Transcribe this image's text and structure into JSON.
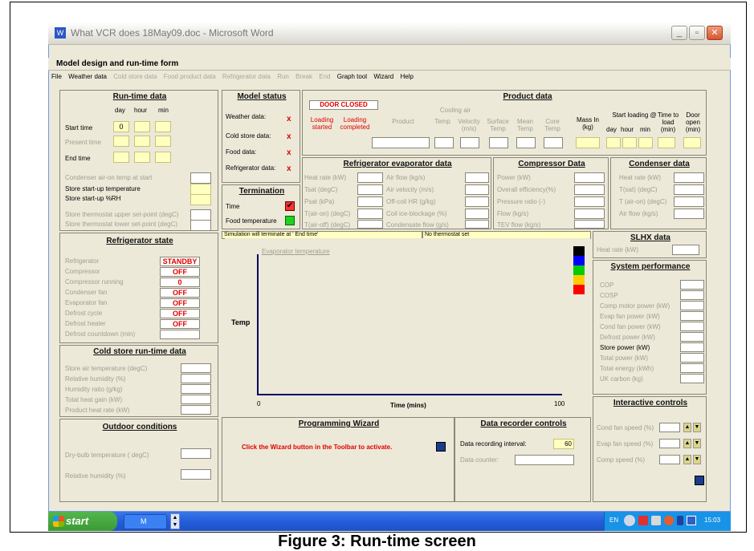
{
  "window": {
    "title": "What VCR does 18May09.doc - Microsoft Word",
    "minimize": "_",
    "restore": "▫",
    "close": "✕"
  },
  "form_title": "Model design and run-time form",
  "menu": [
    {
      "label": "File",
      "enabled": true
    },
    {
      "label": "Weather data",
      "enabled": true
    },
    {
      "label": "Cold store data",
      "enabled": false
    },
    {
      "label": "Food product data",
      "enabled": false
    },
    {
      "label": "Refrigerator data",
      "enabled": false
    },
    {
      "label": "Run",
      "enabled": false
    },
    {
      "label": "Break",
      "enabled": false
    },
    {
      "label": "End",
      "enabled": false
    },
    {
      "label": "Graph tool",
      "enabled": true
    },
    {
      "label": "Wizard",
      "enabled": true
    },
    {
      "label": "Help",
      "enabled": true
    }
  ],
  "runtime": {
    "title": "Run-time data",
    "col_day": "day",
    "col_hour": "hour",
    "col_min": "min",
    "start_time": "Start time",
    "start_day_value": "0",
    "present_time": "Present time",
    "end_time": "End time",
    "condenser_air": "Condenser air-on temp at start",
    "store_startup_temp": "Store start-up temperature",
    "store_startup_rh": "Store start-up %RH",
    "thermo_upper": "Store thermostat upper set-point (degC)",
    "thermo_lower": "Store thermostat lower set-point (degC)"
  },
  "model_status": {
    "title": "Model status",
    "weather": "Weather data:",
    "cold_store": "Cold store data:",
    "food": "Food data:",
    "refrigerator": "Refrigerator data:",
    "x": "x"
  },
  "termination": {
    "title": "Termination",
    "time": "Time",
    "food_temp": "Food temperature",
    "check": "✔"
  },
  "product": {
    "title": "Product data",
    "door": "DOOR CLOSED",
    "loading_started": "Loading started",
    "loading_completed": "Loading completed",
    "product": "Product",
    "cooling_air": "Cooling air",
    "temp": "Temp",
    "velocity": "Velocity (m/s)",
    "surface_temp": "Surface Temp",
    "mean_temp": "Mean Temp",
    "core_temp": "Core Temp",
    "mass": "Mass In (kg)",
    "start_loading": "Start loading @",
    "day": "day",
    "hour": "hour",
    "min": "min",
    "time_to_load": "Time to load (min)",
    "door_open": "Door open (min)"
  },
  "evaporator": {
    "title": "Refrigerator evaporator data",
    "left": [
      "Heat rate (kW)",
      "Tsat (degC)",
      "Psat (kPa)",
      "T(air-on) (degC)",
      "T(air-off) (degC)"
    ],
    "right": [
      "Air flow (kg/s)",
      "Air velocity (m/s)",
      "Off-coil HR (g/kg)",
      "Coil ice-blockage (%)",
      "Condensate flow (g/s)"
    ]
  },
  "compressor": {
    "title": "Compressor Data",
    "rows": [
      "Power (kW)",
      "Overall efficiency(%)",
      "Pressure ratio (-)",
      "Flow (kg/s)",
      "TEV flow (kg/s)"
    ]
  },
  "condenser": {
    "title": "Condenser data",
    "rows": [
      "Heat rate (kW)",
      "T(sat) (degC)",
      "T (air-on) (degC)",
      "Air flow (kg/s)"
    ]
  },
  "refrigerator_state": {
    "title": "Refrigerator state",
    "rows": [
      {
        "label": "Refrigerator",
        "value": "STANDBY"
      },
      {
        "label": "Compressor",
        "value": "OFF"
      },
      {
        "label": "Compressor running",
        "value": "0"
      },
      {
        "label": "Condenser fan",
        "value": "OFF"
      },
      {
        "label": "Evaporator fan",
        "value": "OFF"
      },
      {
        "label": "Defrost cycle",
        "value": "OFF"
      },
      {
        "label": "Defrost heater",
        "value": "OFF"
      },
      {
        "label": "Defrost countdown (min)",
        "value": ""
      }
    ]
  },
  "cold_store": {
    "title": "Cold store run-time data",
    "rows": [
      "Store air temperature  (degC)",
      "Relative humidity (%)",
      "Humidity ratio (g/kg)",
      "Total heat gain (kW)",
      "Product heat rate (kW)"
    ]
  },
  "outdoor": {
    "title": "Outdoor conditions",
    "dry_bulb": "Dry-bulb temperature ( degC)",
    "rh": "Relative humidity (%)"
  },
  "status_bar": {
    "msg1": "Simulation will terminate at ' End time'",
    "msg2": "No thermostat set"
  },
  "chart": {
    "series_label": "Evaporator temperature",
    "ylabel": "Temp",
    "xlabel": "Time (mins)",
    "x_min": "0",
    "x_max": "100",
    "legend_colors": [
      "#000000",
      "#0000ff",
      "#00cc00",
      "#ffcc00",
      "#ff0000"
    ]
  },
  "slhx": {
    "title": "SLHX data",
    "heat_rate": "Heat rate (kW)"
  },
  "performance": {
    "title": "System performance",
    "rows": [
      {
        "label": "COP",
        "active": false
      },
      {
        "label": "COSP",
        "active": false
      },
      {
        "label": "Comp motor power (kW)",
        "active": false
      },
      {
        "label": "Evap fan power (kW)",
        "active": false
      },
      {
        "label": "Cond fan power (kW)",
        "active": false
      },
      {
        "label": "Defrost power (kW)",
        "active": false
      },
      {
        "label": "Store power (kW)",
        "active": true
      },
      {
        "label": "Total power (kW)",
        "active": false
      },
      {
        "label": "Total energy (kWh)",
        "active": false
      },
      {
        "label": "UK carbon  (kg)",
        "active": false
      }
    ]
  },
  "wizard": {
    "title": "Programming Wizard",
    "message": "Click the Wizard button in the Toolbar to activate."
  },
  "recorder": {
    "title": "Data recorder controls",
    "interval_label": "Data recording interval:",
    "interval_value": "60",
    "counter_label": "Data counter:"
  },
  "interactive": {
    "title": "Interactive controls",
    "rows": [
      "Cond fan speed (%)",
      "Evap fan speed (%)",
      "Comp speed (%)"
    ]
  },
  "taskbar": {
    "start": "start",
    "task": "M",
    "lang": "EN",
    "clock": "15:03"
  },
  "caption": "Figure 3: Run-time screen"
}
